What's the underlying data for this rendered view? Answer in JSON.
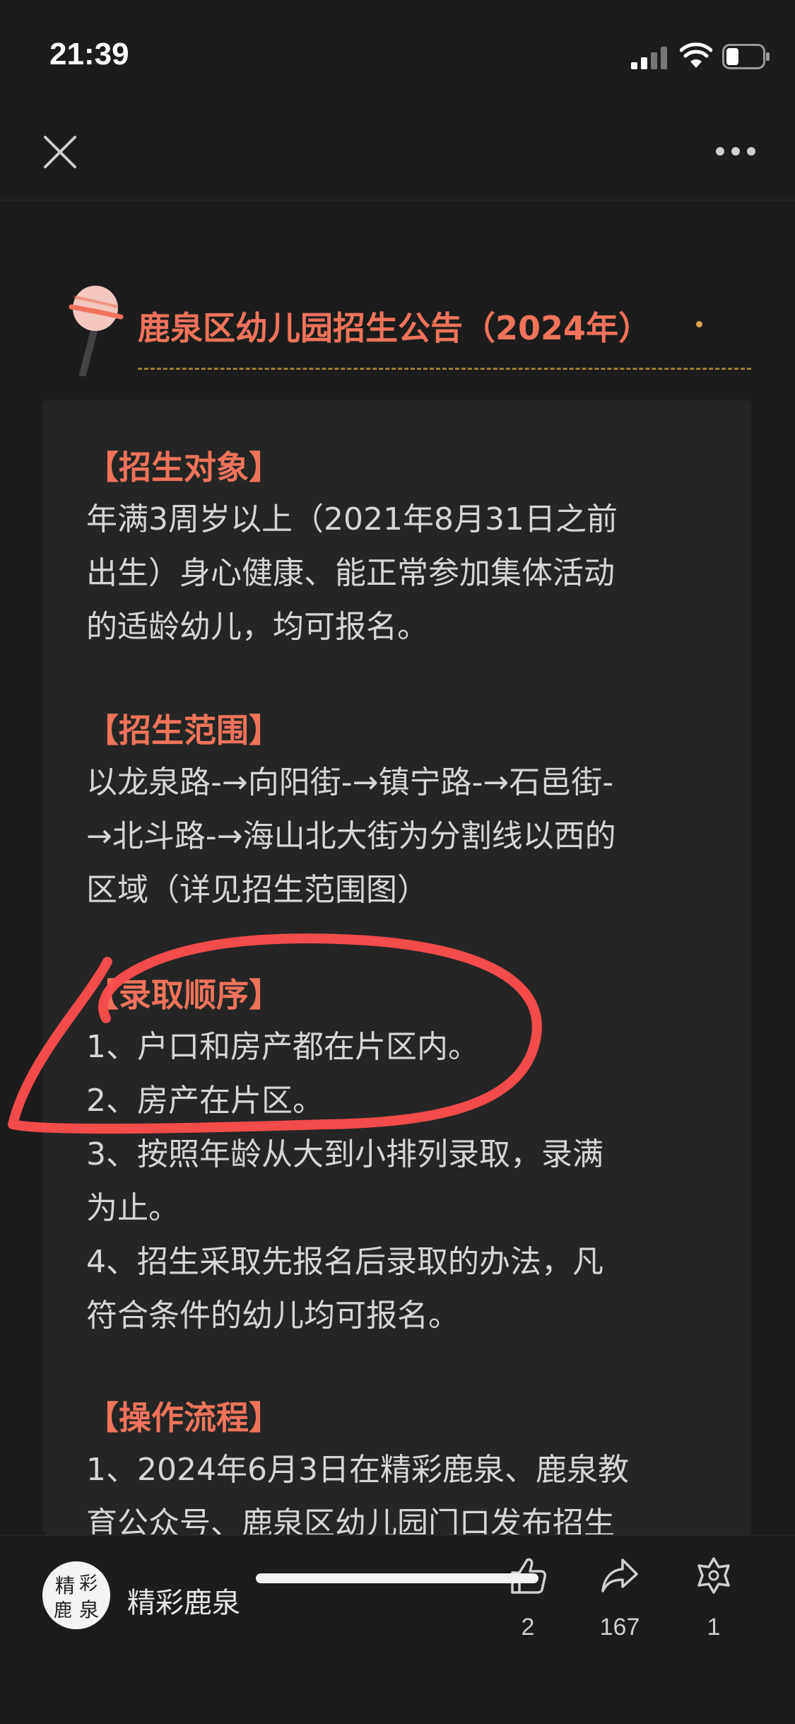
{
  "status_bar": {
    "time": "21:39"
  },
  "nav": {
    "close_icon": "close-icon",
    "more_icon": "more-icon"
  },
  "article": {
    "title": "鹿泉区幼儿园招生公告（2024年）",
    "sections": [
      {
        "heading": "【招生对象】",
        "lines": [
          "年满3周岁以上（2021年8月31日之前",
          "出生）身心健康、能正常参加集体活动",
          "的适龄幼儿，均可报名。"
        ]
      },
      {
        "heading": "【招生范围】",
        "lines": [
          "以龙泉路-→向阳街-→镇宁路-→石邑街-",
          "→北斗路-→海山北大街为分割线以西的",
          "区域（详见招生范围图）"
        ]
      },
      {
        "heading": "【录取顺序】",
        "lines": [
          "1、户口和房产都在片区内。",
          "2、房产在片区。",
          "3、按照年龄从大到小排列录取，录满",
          "为止。",
          "4、招生采取先报名后录取的办法，凡",
          "符合条件的幼儿均可报名。"
        ]
      },
      {
        "heading": "【操作流程】",
        "lines": [
          "1、2024年6月3日在精彩鹿泉、鹿泉教",
          "育公众号、鹿泉区幼儿园门口发布招生"
        ]
      }
    ]
  },
  "toolbar": {
    "account_name": "精彩鹿泉",
    "avatar_text": "精彩鹿泉",
    "like_count": "2",
    "share_count": "167",
    "favorite_count": "1"
  },
  "colors": {
    "background": "#1c1c1c",
    "card": "#252525",
    "accent": "#f0735c",
    "annotation": "#ff4d4d"
  }
}
